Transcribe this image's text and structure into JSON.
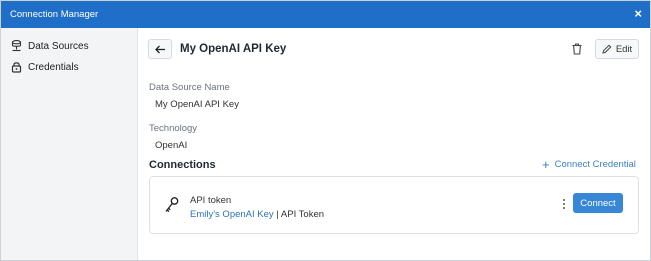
{
  "window": {
    "title": "Connection Manager",
    "close_glyph": "×"
  },
  "sidebar": {
    "items": [
      {
        "label": "Data Sources",
        "icon": "database-icon"
      },
      {
        "label": "Credentials",
        "icon": "lock-icon"
      }
    ]
  },
  "header": {
    "title": "My OpenAI API Key",
    "edit_label": "Edit"
  },
  "fields": {
    "name_label": "Data Source Name",
    "name_value": "My OpenAI API Key",
    "tech_label": "Technology",
    "tech_value": "OpenAI"
  },
  "connections": {
    "title": "Connections",
    "add_label": "Connect Credential",
    "items": [
      {
        "label": "API token",
        "credential_link": "Emily's OpenAI Key",
        "separator": " | ",
        "credential_type": "API Token",
        "action_label": "Connect"
      }
    ]
  },
  "colors": {
    "titlebar": "#1f6fc8",
    "accent": "#3886d6",
    "link": "#2f74b8"
  }
}
